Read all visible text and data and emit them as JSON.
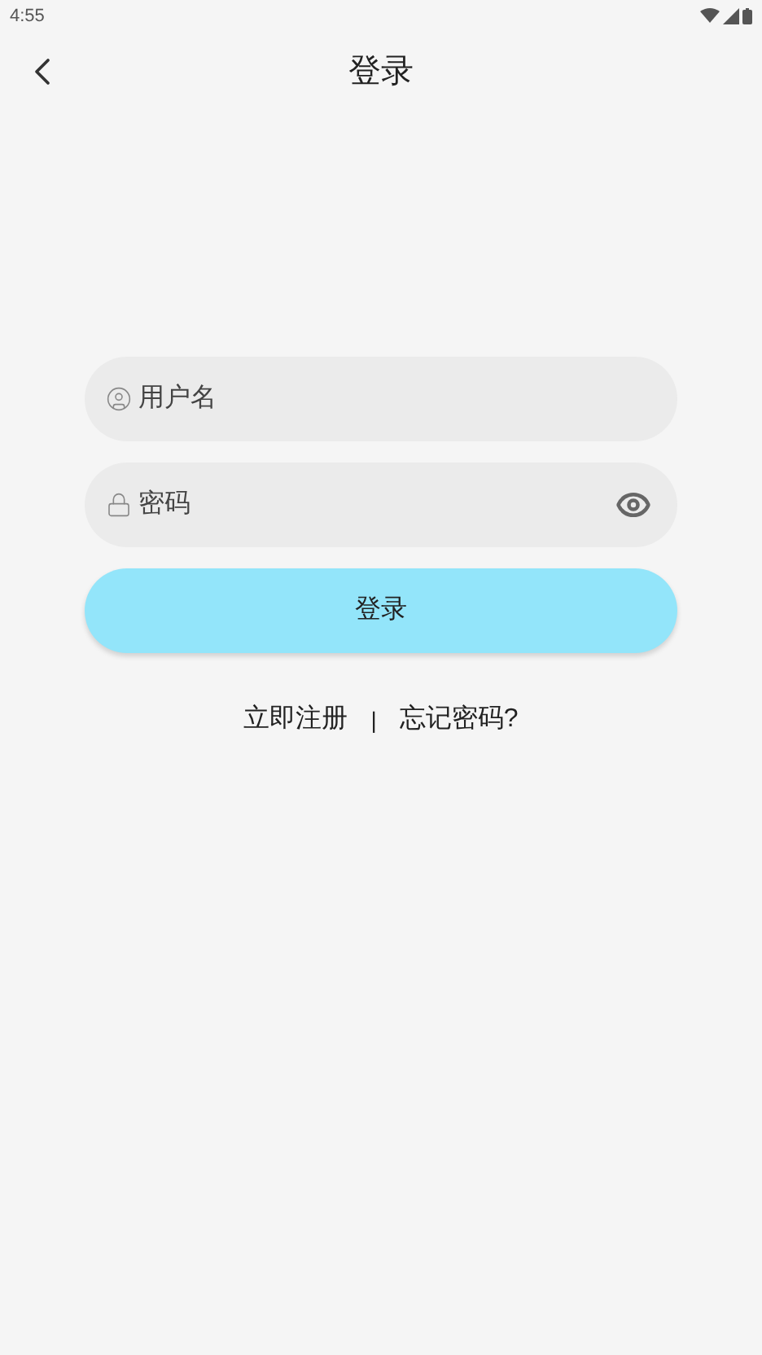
{
  "status_bar": {
    "time": "4:55"
  },
  "header": {
    "title": "登录"
  },
  "username_field": {
    "placeholder": "用户名"
  },
  "password_field": {
    "placeholder": "密码"
  },
  "login_button": {
    "label": "登录"
  },
  "links": {
    "register": "立即注册",
    "separator": "|",
    "forgot": "忘记密码?"
  }
}
